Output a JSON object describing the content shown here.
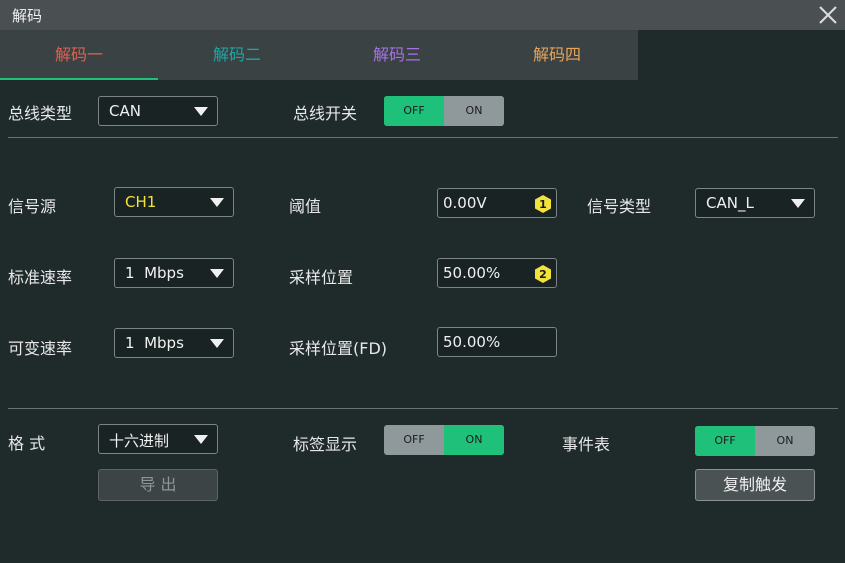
{
  "window": {
    "title": "解码"
  },
  "tabs": [
    {
      "label": "解码一",
      "color": "#e25f4f",
      "active": true
    },
    {
      "label": "解码二",
      "color": "#1aa9a4",
      "active": false
    },
    {
      "label": "解码三",
      "color": "#a872e6",
      "active": false
    },
    {
      "label": "解码四",
      "color": "#e8a55a",
      "active": false
    }
  ],
  "bus": {
    "type_label": "总线类型",
    "type_value": "CAN",
    "switch_label": "总线开关",
    "switch": {
      "off": "OFF",
      "on": "ON",
      "state": "off"
    }
  },
  "signal": {
    "source_label": "信号源",
    "source_value": "CH1",
    "source_color": "#f1e33b",
    "threshold_label": "阈值",
    "threshold_value": "0.00V",
    "threshold_badge": "1",
    "signal_type_label": "信号类型",
    "signal_type_value": "CAN_L",
    "std_rate_label": "标准速率",
    "std_rate_value": "1  Mbps",
    "sample_pos_label": "采样位置",
    "sample_pos_value": "50.00%",
    "sample_pos_badge": "2",
    "var_rate_label": "可变速率",
    "var_rate_value": "1  Mbps",
    "sample_pos_fd_label": "采样位置(FD)",
    "sample_pos_fd_value": "50.00%"
  },
  "format": {
    "label": "格 式",
    "value": "十六进制",
    "export_label": "导 出",
    "tag_label": "标签显示",
    "tag_switch": {
      "off": "OFF",
      "on": "ON",
      "state": "on"
    },
    "event_label": "事件表",
    "event_switch": {
      "off": "OFF",
      "on": "ON",
      "state": "off"
    },
    "copy_trigger_label": "复制触发"
  },
  "colors": {
    "accent": "#1ec07a",
    "badge": "#f1e33b"
  },
  "icons": {
    "close": "close-icon",
    "dropdown": "chevron-down-icon",
    "badge": "hexagon-badge-icon"
  }
}
